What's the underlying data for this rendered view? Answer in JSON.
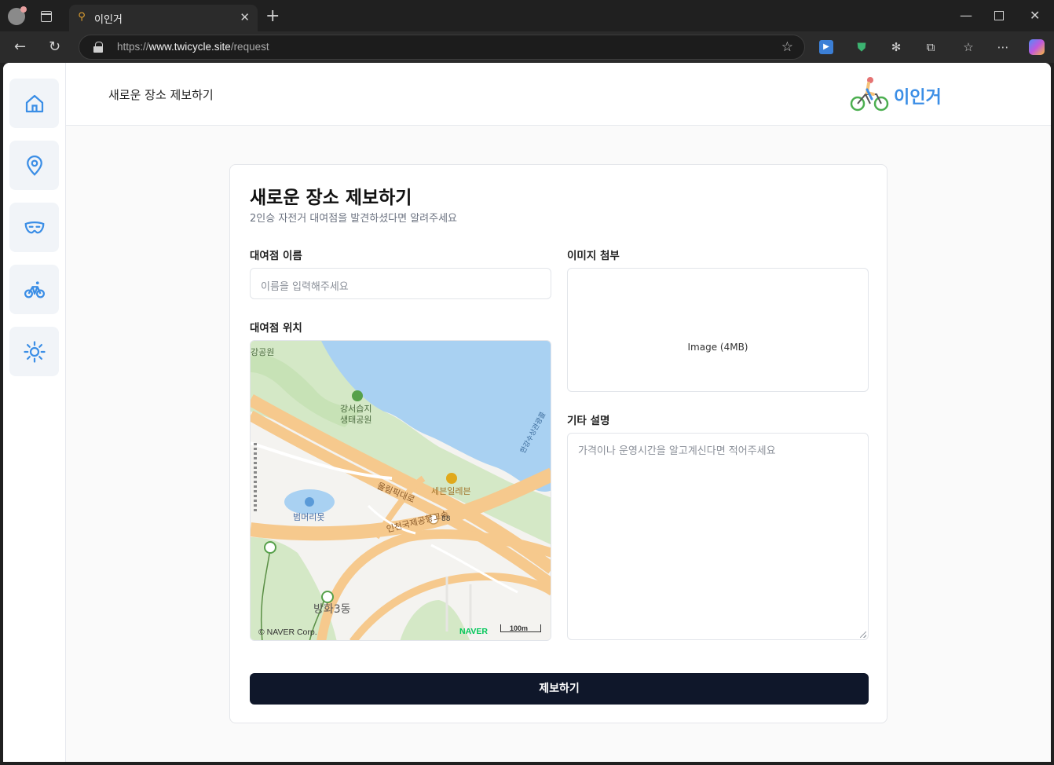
{
  "browser": {
    "tab_title": "이인거",
    "url_prefix": "https://",
    "url_domain": "www.twicycle.site",
    "url_path": "/request",
    "icons": [
      "profile-icon",
      "tabs-icon",
      "back-icon",
      "refresh-icon",
      "lock-icon",
      "star-icon",
      "extension-icons",
      "more-icon"
    ]
  },
  "sidebar": {
    "items": [
      {
        "name": "home",
        "icon": "home-icon"
      },
      {
        "name": "location",
        "icon": "map-pin-icon"
      },
      {
        "name": "mask",
        "icon": "mask-icon"
      },
      {
        "name": "bicycle",
        "icon": "bicycle-icon"
      },
      {
        "name": "theme",
        "icon": "sun-icon"
      }
    ],
    "accent": "#3b8ee6"
  },
  "header": {
    "title": "새로운 장소 제보하기",
    "logo_text": "이인거"
  },
  "form": {
    "title": "새로운 장소 제보하기",
    "subtitle": "2인승 자전거 대여점을 발견하셨다면 알려주세요",
    "name_label": "대여점 이름",
    "name_placeholder": "이름을 입력해주세요",
    "location_label": "대여점 위치",
    "image_label": "이미지 첨부",
    "image_text": "Image (4MB)",
    "desc_label": "기타 설명",
    "desc_placeholder": "가격이나 운영시간을 알고계신다면 적어주세요",
    "submit_label": "제보하기",
    "submit_color": "#0f172a"
  },
  "map": {
    "labels": {
      "park_edge": "강공원",
      "wetland": "강서습지",
      "wetland2": "생태공원",
      "seven": "세븐일레븐",
      "olympic": "올림픽대로",
      "pond": "범머리못",
      "incheon": "인천국제공항고속",
      "route": "88",
      "dong": "방화3동",
      "bridge": "한강수상관광콜"
    },
    "copyright": "© NAVER Corp.",
    "brand": "NAVER",
    "scale": "100m"
  }
}
